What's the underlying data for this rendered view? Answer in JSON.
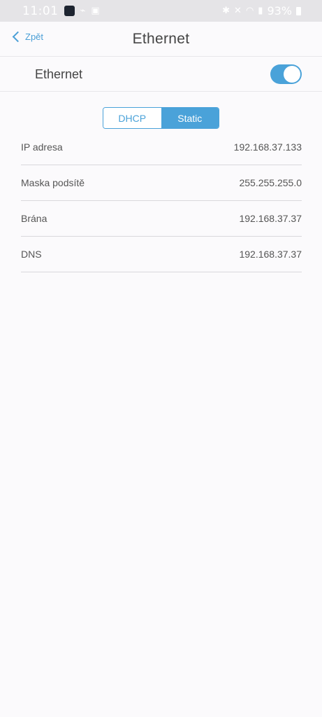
{
  "status_bar": {
    "time": "11:01",
    "battery": "93%",
    "icons": [
      "app-icon",
      "cast-icon",
      "gallery-icon",
      "bluetooth-icon",
      "mute-icon",
      "wifi-icon",
      "volte-signal-icon",
      "battery-icon"
    ]
  },
  "nav": {
    "back_label": "Zpět",
    "title": "Ethernet"
  },
  "ethernet": {
    "label": "Ethernet",
    "enabled": true
  },
  "mode_segment": {
    "options": [
      "DHCP",
      "Static"
    ],
    "selected": "Static"
  },
  "fields": [
    {
      "label": "IP adresa",
      "value": "192.168.37.133"
    },
    {
      "label": "Maska podsítě",
      "value": "255.255.255.0"
    },
    {
      "label": "Brána",
      "value": "192.168.37.37"
    },
    {
      "label": "DNS",
      "value": "192.168.37.37"
    }
  ],
  "colors": {
    "accent": "#4aa2d9",
    "background": "#fbfafc",
    "status_bar": "#e5e4e7"
  }
}
